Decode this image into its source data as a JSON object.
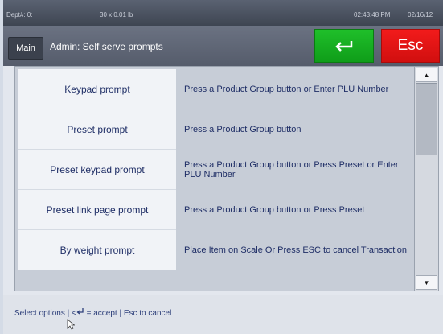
{
  "status": {
    "dept": "Dept#: 0:",
    "weight": "30 x 0.01 lb",
    "time": "02:43:48 PM",
    "date": "02/16/12"
  },
  "titlebar": {
    "main_label": "Main",
    "title": "Admin: Self serve prompts",
    "esc_label": "Esc"
  },
  "rows": [
    {
      "label": "Keypad prompt",
      "desc": "Press a Product Group button or Enter PLU Number"
    },
    {
      "label": "Preset prompt",
      "desc": "Press a Product Group button"
    },
    {
      "label": "Preset keypad prompt",
      "desc": "Press a Product Group button or Press Preset or Enter PLU Number"
    },
    {
      "label": "Preset link page prompt",
      "desc": "Press a Product Group button or Press Preset"
    },
    {
      "label": "By weight prompt",
      "desc": "Place Item on Scale Or Press ESC to cancel Transaction"
    }
  ],
  "footer": {
    "prefix": "Select options | <",
    "suffix": " = accept | Esc to cancel"
  },
  "colors": {
    "accept": "#17b021",
    "esc": "#e51515",
    "text": "#1f2e66"
  }
}
